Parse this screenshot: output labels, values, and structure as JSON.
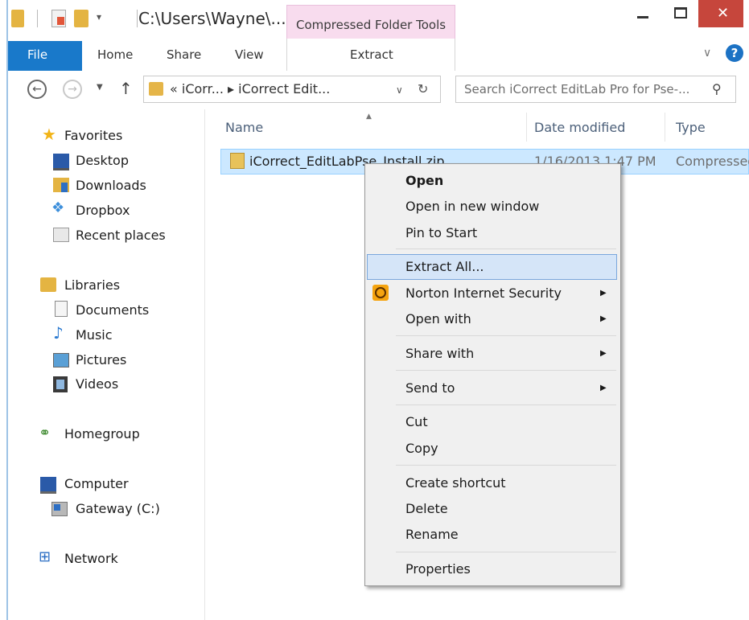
{
  "titlebar": {
    "path": "C:\\Users\\Wayne\\...",
    "context_tab_group": "Compressed Folder Tools",
    "close_glyph": "✕"
  },
  "ribbon": {
    "tabs": [
      "File",
      "Home",
      "Share",
      "View",
      "Extract"
    ],
    "help_glyph": "?"
  },
  "address": {
    "breadcrumb": "« iCorr... ▸ iCorrect Edit...",
    "search_placeholder": "Search iCorrect EditLab Pro for Pse-..."
  },
  "nav": {
    "favorites": {
      "label": "Favorites",
      "items": [
        "Desktop",
        "Downloads",
        "Dropbox",
        "Recent places"
      ]
    },
    "libraries": {
      "label": "Libraries",
      "items": [
        "Documents",
        "Music",
        "Pictures",
        "Videos"
      ]
    },
    "homegroup": "Homegroup",
    "computer": {
      "label": "Computer",
      "items": [
        "Gateway (C:)"
      ]
    },
    "network": "Network"
  },
  "columns": {
    "name": "Name",
    "date": "Date modified",
    "type": "Type"
  },
  "file": {
    "name": "iCorrect_EditLabPse_Install.zip",
    "date": "1/16/2013 1:47 PM",
    "type": "Compressed"
  },
  "context_menu": {
    "open": "Open",
    "open_new_window": "Open in new window",
    "pin_to_start": "Pin to Start",
    "extract_all": "Extract All...",
    "norton": "Norton Internet Security",
    "open_with": "Open with",
    "share_with": "Share with",
    "send_to": "Send to",
    "cut": "Cut",
    "copy": "Copy",
    "create_shortcut": "Create shortcut",
    "delete": "Delete",
    "rename": "Rename",
    "properties": "Properties",
    "submenu_arrow": "▶"
  },
  "colors": {
    "file_tab": "#1979ca",
    "context_tab": "#f8dcee",
    "close_button": "#c6463c",
    "selection": "#cce8ff",
    "menu_highlight": "#d5e5f8"
  }
}
